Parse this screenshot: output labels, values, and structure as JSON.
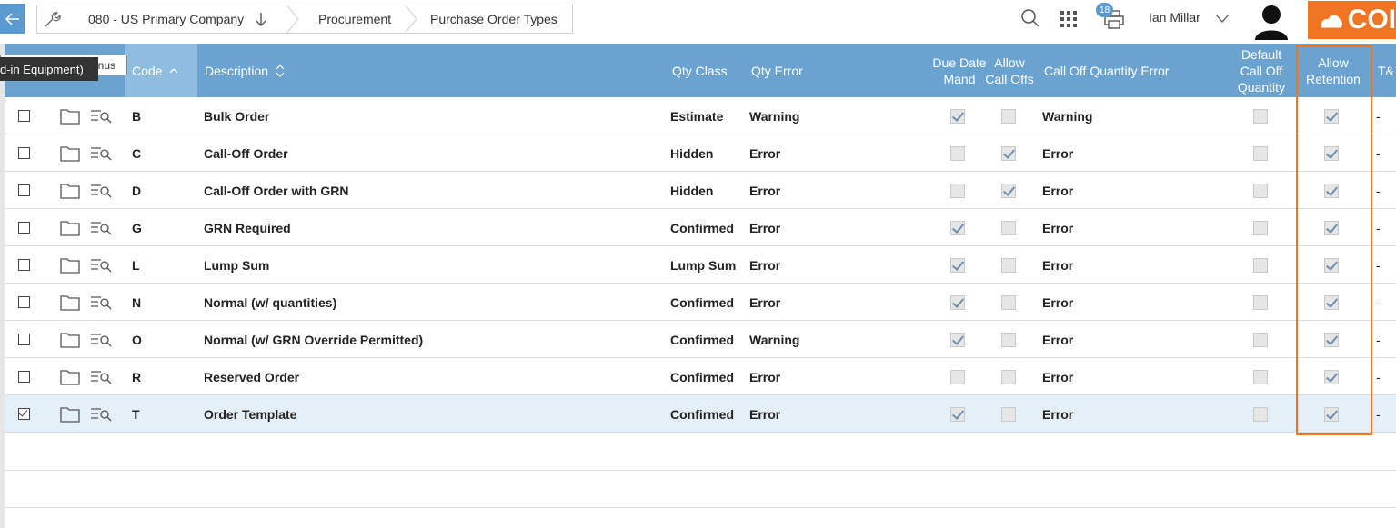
{
  "header": {
    "company": "080 - US Primary Company",
    "module": "Procurement",
    "page": "Purchase Order Types",
    "notification_count": "18",
    "user_name": "Ian Millar",
    "brand": "COI"
  },
  "tooltips": {
    "back": "enus",
    "front": "d-in Equipment)"
  },
  "columns": {
    "code": "Code",
    "description": "Description",
    "qty_class": "Qty Class",
    "qty_error": "Qty Error",
    "due_date_mand": "Due Date Mand",
    "allow_call_offs": "Allow Call Offs",
    "call_off_qty_error": "Call Off Quantity Error",
    "default_call_off_qty": "Default Call Off Quantity",
    "allow_retention": "Allow Retention",
    "tc": "T&"
  },
  "rows": [
    {
      "selected": false,
      "code": "B",
      "description": "Bulk Order",
      "qty_class": "Estimate",
      "qty_error": "Warning",
      "due_date_mand": true,
      "allow_call_offs": false,
      "call_off_qty_error": "Warning",
      "default_call_off_qty": false,
      "allow_retention": true,
      "tc": "-"
    },
    {
      "selected": false,
      "code": "C",
      "description": "Call-Off Order",
      "qty_class": "Hidden",
      "qty_error": "Error",
      "due_date_mand": false,
      "allow_call_offs": true,
      "call_off_qty_error": "Error",
      "default_call_off_qty": false,
      "allow_retention": true,
      "tc": "-"
    },
    {
      "selected": false,
      "code": "D",
      "description": "Call-Off Order with GRN",
      "qty_class": "Hidden",
      "qty_error": "Error",
      "due_date_mand": false,
      "allow_call_offs": true,
      "call_off_qty_error": "Error",
      "default_call_off_qty": false,
      "allow_retention": true,
      "tc": "-"
    },
    {
      "selected": false,
      "code": "G",
      "description": "GRN Required",
      "qty_class": "Confirmed",
      "qty_error": "Error",
      "due_date_mand": true,
      "allow_call_offs": false,
      "call_off_qty_error": "Error",
      "default_call_off_qty": false,
      "allow_retention": true,
      "tc": "-"
    },
    {
      "selected": false,
      "code": "L",
      "description": "Lump Sum",
      "qty_class": "Lump Sum",
      "qty_error": "Error",
      "due_date_mand": true,
      "allow_call_offs": false,
      "call_off_qty_error": "Error",
      "default_call_off_qty": false,
      "allow_retention": true,
      "tc": "-"
    },
    {
      "selected": false,
      "code": "N",
      "description": "Normal (w/ quantities)",
      "qty_class": "Confirmed",
      "qty_error": "Error",
      "due_date_mand": true,
      "allow_call_offs": false,
      "call_off_qty_error": "Error",
      "default_call_off_qty": false,
      "allow_retention": true,
      "tc": "-"
    },
    {
      "selected": false,
      "code": "O",
      "description": "Normal (w/ GRN Override Permitted)",
      "qty_class": "Confirmed",
      "qty_error": "Warning",
      "due_date_mand": true,
      "allow_call_offs": false,
      "call_off_qty_error": "Error",
      "default_call_off_qty": false,
      "allow_retention": true,
      "tc": "-"
    },
    {
      "selected": false,
      "code": "R",
      "description": "Reserved Order",
      "qty_class": "Confirmed",
      "qty_error": "Error",
      "due_date_mand": false,
      "allow_call_offs": false,
      "call_off_qty_error": "Error",
      "default_call_off_qty": false,
      "allow_retention": true,
      "tc": "-"
    },
    {
      "selected": true,
      "code": "T",
      "description": "Order Template",
      "qty_class": "Confirmed",
      "qty_error": "Error",
      "due_date_mand": true,
      "allow_call_offs": false,
      "call_off_qty_error": "Error",
      "default_call_off_qty": false,
      "allow_retention": true,
      "tc": "-"
    }
  ],
  "colors": {
    "header_bg": "#6ba3d0",
    "sorted_header_bg": "#8ebde0",
    "selected_row_bg": "#e4eff7",
    "highlight_border": "#f07522",
    "brand_orange": "#f07522"
  }
}
